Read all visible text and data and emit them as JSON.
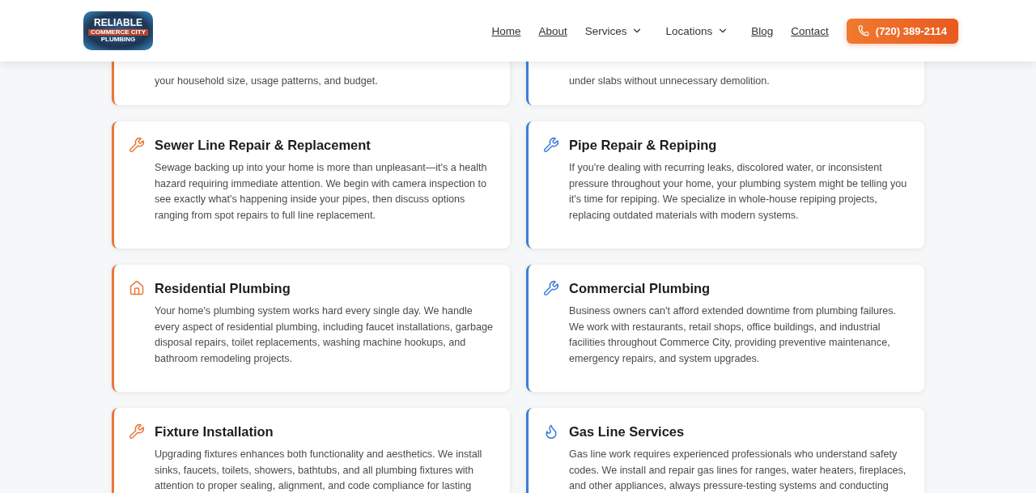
{
  "header": {
    "logo": {
      "lines": [
        "RELIABLE",
        "COMMERCE CITY",
        "PLUMBING"
      ]
    },
    "nav": [
      {
        "label": "Home",
        "kind": "link"
      },
      {
        "label": "About",
        "kind": "link"
      },
      {
        "label": "Services",
        "kind": "dropdown"
      },
      {
        "label": "Locations",
        "kind": "dropdown"
      },
      {
        "label": "Blog",
        "kind": "link"
      },
      {
        "label": "Contact",
        "kind": "link"
      }
    ],
    "phone_button": "(720) 389-2114"
  },
  "services": [
    {
      "text": "your household size, usage patterns, and budget.",
      "kind": "none",
      "color": "#e8773a"
    },
    {
      "text": "under slabs without unnecessary demolition.",
      "kind": "none",
      "color": "#3b7fd4"
    },
    {
      "title": "Sewer Line Repair & Replacement",
      "text": "Sewage backing up into your home is more than unpleasant—it's a health hazard requiring immediate attention. We begin with camera inspection to see exactly what's happening inside your pipes, then discuss options ranging from spot repairs to full line replacement.",
      "kind": "wrench",
      "color": "#e8773a"
    },
    {
      "title": "Pipe Repair & Repiping",
      "text": "If you're dealing with recurring leaks, discolored water, or inconsistent pressure throughout your home, your plumbing system might be telling you it's time for repiping. We specialize in whole-house repiping projects, replacing outdated materials with modern systems.",
      "kind": "wrench",
      "color": "#3b7fd4"
    },
    {
      "title": "Residential Plumbing",
      "text": "Your home's plumbing system works hard every single day. We handle every aspect of residential plumbing, including faucet installations, garbage disposal repairs, toilet replacements, washing machine hookups, and bathroom remodeling projects.",
      "kind": "house",
      "color": "#e8773a"
    },
    {
      "title": "Commercial Plumbing",
      "text": "Business owners can't afford extended downtime from plumbing failures. We work with restaurants, retail shops, office buildings, and industrial facilities throughout Commerce City, providing preventive maintenance, emergency repairs, and system upgrades.",
      "kind": "wrench",
      "color": "#3b7fd4"
    },
    {
      "title": "Fixture Installation",
      "text": "Upgrading fixtures enhances both functionality and aesthetics. We install sinks, faucets, toilets, showers, bathtubs, and all plumbing fixtures with attention to proper sealing, alignment, and code compliance for lasting",
      "kind": "wrench",
      "color": "#e8773a"
    },
    {
      "title": "Gas Line Services",
      "text": "Gas line work requires experienced professionals who understand safety codes. We install and repair gas lines for ranges, water heaters, fireplaces, and other appliances, always pressure-testing systems and conducting",
      "kind": "flame",
      "color": "#3b7fd4"
    }
  ]
}
